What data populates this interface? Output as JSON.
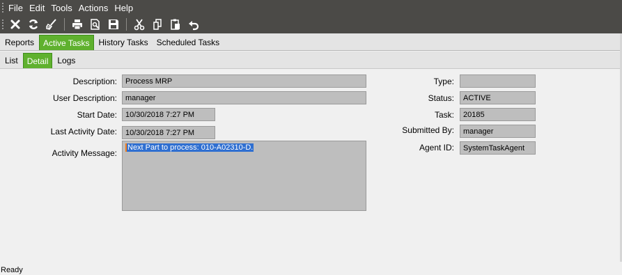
{
  "menu": [
    "File",
    "Edit",
    "Tools",
    "Actions",
    "Help"
  ],
  "toolbar_icons": [
    "close-icon",
    "refresh-icon",
    "clear-icon",
    "print-icon",
    "print-preview-icon",
    "save-icon",
    "cut-icon",
    "copy-icon",
    "paste-icon",
    "undo-icon"
  ],
  "tabs_primary": [
    {
      "label": "Reports",
      "active": false
    },
    {
      "label": "Active Tasks",
      "active": true
    },
    {
      "label": "History Tasks",
      "active": false
    },
    {
      "label": "Scheduled Tasks",
      "active": false
    }
  ],
  "tabs_secondary": [
    {
      "label": "List",
      "active": false
    },
    {
      "label": "Detail",
      "active": true
    },
    {
      "label": "Logs",
      "active": false
    }
  ],
  "form": {
    "description_label": "Description:",
    "description": "Process MRP",
    "user_description_label": "User Description:",
    "user_description": "manager",
    "start_date_label": "Start Date:",
    "start_date": "10/30/2018 7:27 PM",
    "last_activity_label": "Last Activity Date:",
    "last_activity": "10/30/2018 7:27 PM",
    "activity_message_label": "Activity Message:",
    "activity_message": "Next Part to process: 010-A02310-D.",
    "type_label": "Type:",
    "type": "",
    "status_label": "Status:",
    "status": "ACTIVE",
    "task_label": "Task:",
    "task": "20185",
    "submitted_by_label": "Submitted By:",
    "submitted_by": "manager",
    "agent_id_label": "Agent ID:",
    "agent_id": "SystemTaskAgent"
  },
  "status_bar": "Ready",
  "colors": {
    "chrome": "#4b4a47",
    "tab_active": "#5fb12e",
    "field_bg": "#bebebe",
    "selection": "#2f6fd1"
  }
}
